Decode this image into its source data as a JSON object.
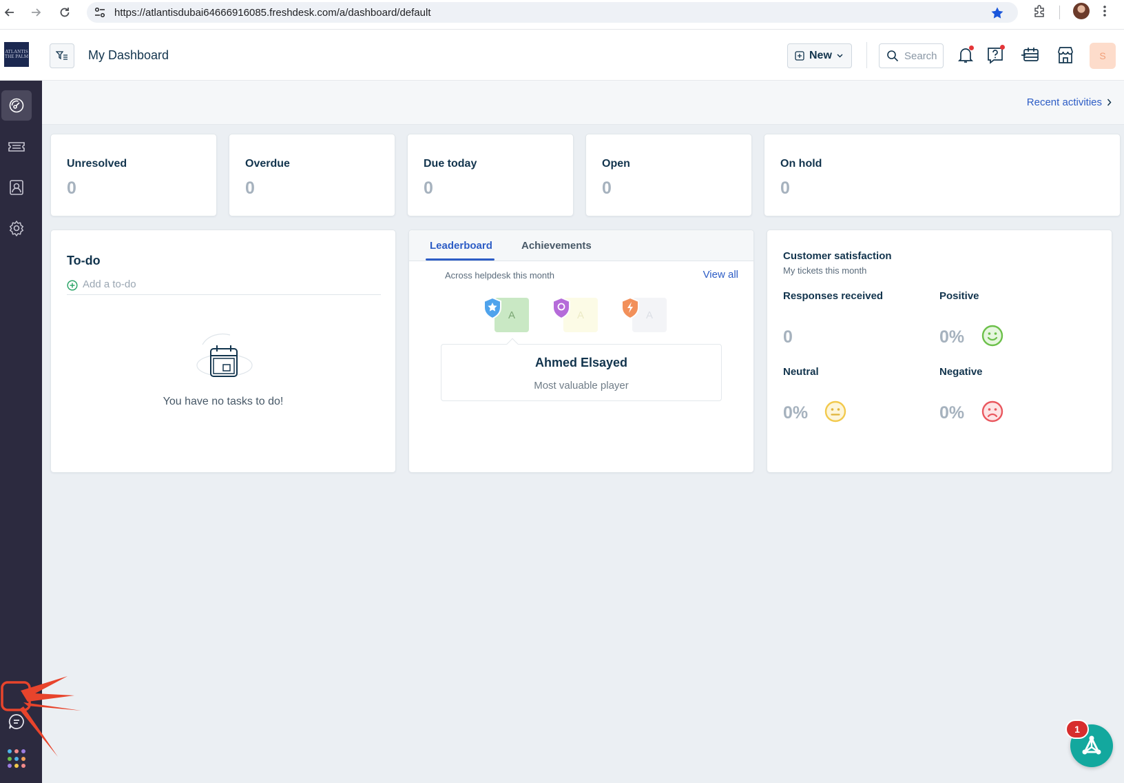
{
  "browser": {
    "url": "https://atlantisdubai64666916085.freshdesk.com/a/dashboard/default"
  },
  "header": {
    "logo_text": "ATLANTIS THE PALM",
    "title": "My Dashboard",
    "new_label": "New",
    "search_placeholder": "Search",
    "avatar_initial": "S"
  },
  "sidebar": {
    "items": [
      {
        "name": "dashboard",
        "icon": "gauge-icon",
        "active": true
      },
      {
        "name": "tickets",
        "icon": "ticket-icon",
        "active": false
      },
      {
        "name": "contacts",
        "icon": "contact-card-icon",
        "active": false
      },
      {
        "name": "admin",
        "icon": "gear-icon",
        "active": false
      }
    ]
  },
  "recent_activities": "Recent activities",
  "stats": [
    {
      "label": "Unresolved",
      "value": "0"
    },
    {
      "label": "Overdue",
      "value": "0"
    },
    {
      "label": "Due today",
      "value": "0"
    },
    {
      "label": "Open",
      "value": "0"
    },
    {
      "label": "On hold",
      "value": "0"
    }
  ],
  "todo": {
    "title": "To-do",
    "add_placeholder": "Add a to-do",
    "empty_text": "You have no tasks to do!"
  },
  "leaderboard": {
    "tabs": [
      "Leaderboard",
      "Achievements"
    ],
    "subtitle": "Across helpdesk this month",
    "view_all": "View all",
    "avatars": [
      "A",
      "A",
      "A"
    ],
    "mvp_name": "Ahmed Elsayed",
    "mvp_role": "Most valuable player"
  },
  "satisfaction": {
    "title": "Customer satisfaction",
    "subtitle": "My tickets this month",
    "responses_label": "Responses received",
    "responses_value": "0",
    "positive_label": "Positive",
    "positive_value": "0%",
    "neutral_label": "Neutral",
    "neutral_value": "0%",
    "negative_label": "Negative",
    "negative_value": "0%"
  },
  "widget": {
    "badge": "1"
  },
  "colors": {
    "sidebar": "#2c2a3f",
    "link": "#2c5cc5",
    "positive": "#6cc04a",
    "neutral": "#f2c94c",
    "negative": "#e9575e",
    "widget": "#13a89e"
  }
}
